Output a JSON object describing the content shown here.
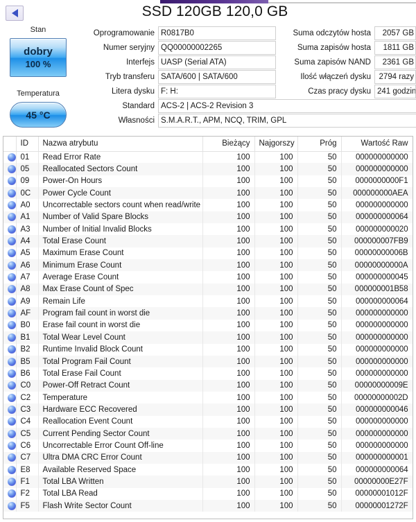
{
  "window": {
    "back_button_icon": "left-arrow-icon",
    "device_title": "SSD 120GB 120,0 GB"
  },
  "health": {
    "label": "Stan",
    "status": "dobry",
    "percent": "100 %",
    "badge_color": "#2ea2ef"
  },
  "temperature": {
    "label": "Temperatura",
    "value": "45 °C",
    "badge_color": "#2ea2ef"
  },
  "info_left": [
    {
      "label": "Oprogramowanie",
      "value": "R0817B0"
    },
    {
      "label": "Numer seryjny",
      "value": "QQ00000002265"
    },
    {
      "label": "Interfejs",
      "value": "UASP (Serial ATA)"
    },
    {
      "label": "Tryb transferu",
      "value": "SATA/600 | SATA/600"
    },
    {
      "label": "Litera dysku",
      "value": "F: H:"
    }
  ],
  "info_right": [
    {
      "label": "Suma odczytów hosta",
      "value": "2057 GB"
    },
    {
      "label": "Suma zapisów hosta",
      "value": "1811 GB"
    },
    {
      "label": "Suma zapisów NAND",
      "value": "2361 GB"
    },
    {
      "label": "Ilość włączeń dysku",
      "value": "2794 razy"
    },
    {
      "label": "Czas pracy dysku",
      "value": "241 godzin"
    }
  ],
  "info_wide": [
    {
      "label": "Standard",
      "value": "ACS-2 | ACS-2 Revision 3"
    },
    {
      "label": "Własności",
      "value": "S.M.A.R.T., APM, NCQ, TRIM, GPL"
    }
  ],
  "table": {
    "headers": {
      "icon": "",
      "id": "ID",
      "name": "Nazwa atrybutu",
      "current": "Bieżący",
      "worst": "Najgorszy",
      "threshold": "Próg",
      "raw": "Wartość Raw"
    },
    "status_icon": "blue-sphere-icon",
    "rows": [
      {
        "id": "01",
        "name": "Read Error Rate",
        "current": "100",
        "worst": "100",
        "threshold": "50",
        "raw": "000000000000"
      },
      {
        "id": "05",
        "name": "Reallocated Sectors Count",
        "current": "100",
        "worst": "100",
        "threshold": "50",
        "raw": "000000000000"
      },
      {
        "id": "09",
        "name": "Power-On Hours",
        "current": "100",
        "worst": "100",
        "threshold": "50",
        "raw": "0000000000F1"
      },
      {
        "id": "0C",
        "name": "Power Cycle Count",
        "current": "100",
        "worst": "100",
        "threshold": "50",
        "raw": "000000000AEA"
      },
      {
        "id": "A0",
        "name": "Uncorrectable sectors count when read/write",
        "current": "100",
        "worst": "100",
        "threshold": "50",
        "raw": "000000000000"
      },
      {
        "id": "A1",
        "name": "Number of Valid Spare Blocks",
        "current": "100",
        "worst": "100",
        "threshold": "50",
        "raw": "000000000064"
      },
      {
        "id": "A3",
        "name": "Number of Initial Invalid Blocks",
        "current": "100",
        "worst": "100",
        "threshold": "50",
        "raw": "000000000020"
      },
      {
        "id": "A4",
        "name": "Total Erase Count",
        "current": "100",
        "worst": "100",
        "threshold": "50",
        "raw": "000000007FB9"
      },
      {
        "id": "A5",
        "name": "Maximum Erase Count",
        "current": "100",
        "worst": "100",
        "threshold": "50",
        "raw": "00000000006B"
      },
      {
        "id": "A6",
        "name": "Minimum Erase Count",
        "current": "100",
        "worst": "100",
        "threshold": "50",
        "raw": "00000000000A"
      },
      {
        "id": "A7",
        "name": "Average Erase Count",
        "current": "100",
        "worst": "100",
        "threshold": "50",
        "raw": "000000000045"
      },
      {
        "id": "A8",
        "name": "Max Erase Count of Spec",
        "current": "100",
        "worst": "100",
        "threshold": "50",
        "raw": "000000001B58"
      },
      {
        "id": "A9",
        "name": "Remain Life",
        "current": "100",
        "worst": "100",
        "threshold": "50",
        "raw": "000000000064"
      },
      {
        "id": "AF",
        "name": "Program fail count in worst die",
        "current": "100",
        "worst": "100",
        "threshold": "50",
        "raw": "000000000000"
      },
      {
        "id": "B0",
        "name": "Erase fail count in worst die",
        "current": "100",
        "worst": "100",
        "threshold": "50",
        "raw": "000000000000"
      },
      {
        "id": "B1",
        "name": "Total Wear Level Count",
        "current": "100",
        "worst": "100",
        "threshold": "50",
        "raw": "000000000000"
      },
      {
        "id": "B2",
        "name": "Runtime Invalid Block Count",
        "current": "100",
        "worst": "100",
        "threshold": "50",
        "raw": "000000000000"
      },
      {
        "id": "B5",
        "name": "Total Program Fail Count",
        "current": "100",
        "worst": "100",
        "threshold": "50",
        "raw": "000000000000"
      },
      {
        "id": "B6",
        "name": "Total Erase Fail Count",
        "current": "100",
        "worst": "100",
        "threshold": "50",
        "raw": "000000000000"
      },
      {
        "id": "C0",
        "name": "Power-Off Retract Count",
        "current": "100",
        "worst": "100",
        "threshold": "50",
        "raw": "00000000009E"
      },
      {
        "id": "C2",
        "name": "Temperature",
        "current": "100",
        "worst": "100",
        "threshold": "50",
        "raw": "00000000002D"
      },
      {
        "id": "C3",
        "name": "Hardware ECC Recovered",
        "current": "100",
        "worst": "100",
        "threshold": "50",
        "raw": "000000000046"
      },
      {
        "id": "C4",
        "name": "Reallocation Event Count",
        "current": "100",
        "worst": "100",
        "threshold": "50",
        "raw": "000000000000"
      },
      {
        "id": "C5",
        "name": "Current Pending Sector Count",
        "current": "100",
        "worst": "100",
        "threshold": "50",
        "raw": "000000000000"
      },
      {
        "id": "C6",
        "name": "Uncorrectable Error Count Off-line",
        "current": "100",
        "worst": "100",
        "threshold": "50",
        "raw": "000000000000"
      },
      {
        "id": "C7",
        "name": "Ultra DMA CRC Error Count",
        "current": "100",
        "worst": "100",
        "threshold": "50",
        "raw": "000000000001"
      },
      {
        "id": "E8",
        "name": "Available Reserved Space",
        "current": "100",
        "worst": "100",
        "threshold": "50",
        "raw": "000000000064"
      },
      {
        "id": "F1",
        "name": "Total LBA Written",
        "current": "100",
        "worst": "100",
        "threshold": "50",
        "raw": "00000000E27F"
      },
      {
        "id": "F2",
        "name": "Total LBA Read",
        "current": "100",
        "worst": "100",
        "threshold": "50",
        "raw": "00000001012F"
      },
      {
        "id": "F5",
        "name": "Flash Write Sector Count",
        "current": "100",
        "worst": "100",
        "threshold": "50",
        "raw": "00000001272F"
      }
    ]
  }
}
